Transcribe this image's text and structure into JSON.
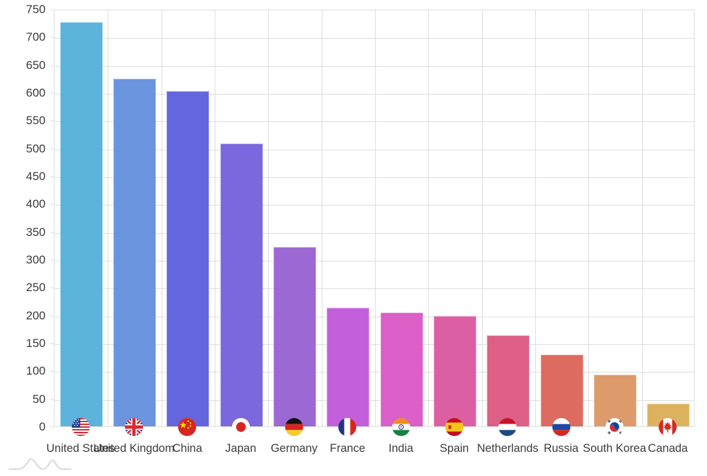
{
  "chart_data": {
    "type": "bar",
    "title": "",
    "subtitle": "",
    "xlabel": "",
    "ylabel": "",
    "ylim": [
      0,
      750
    ],
    "grid": true,
    "legend": "none",
    "y_ticks": [
      0,
      50,
      100,
      150,
      200,
      250,
      300,
      350,
      400,
      450,
      500,
      550,
      600,
      650,
      700,
      750
    ],
    "categories": [
      "United States",
      "United Kingdom",
      "China",
      "Japan",
      "Germany",
      "France",
      "India",
      "Spain",
      "Netherlands",
      "Russia",
      "South Korea",
      "Canada"
    ],
    "values": [
      726,
      625,
      602,
      508,
      322,
      213,
      204,
      198,
      164,
      129,
      93,
      41
    ],
    "bar_colors": [
      "#5cb3dc",
      "#6a94de",
      "#6366dc",
      "#7b68de",
      "#9c68d4",
      "#c45fdb",
      "#db5fc7",
      "#dd5fa3",
      "#dd5f85",
      "#dd6b60",
      "#dd9b6b",
      "#ddb25f"
    ],
    "point_icons": [
      "flag-united-states-icon",
      "flag-united-kingdom-icon",
      "flag-china-icon",
      "flag-japan-icon",
      "flag-germany-icon",
      "flag-france-icon",
      "flag-india-icon",
      "flag-spain-icon",
      "flag-netherlands-icon",
      "flag-russia-icon",
      "flag-south-korea-icon",
      "flag-canada-icon"
    ],
    "axis_color": "#dededd",
    "label_color": "#3b3b3b",
    "background_color": "#ffffff"
  },
  "watermark": {
    "name": "chart-watermark-logo",
    "color": "#d8d8d8"
  }
}
